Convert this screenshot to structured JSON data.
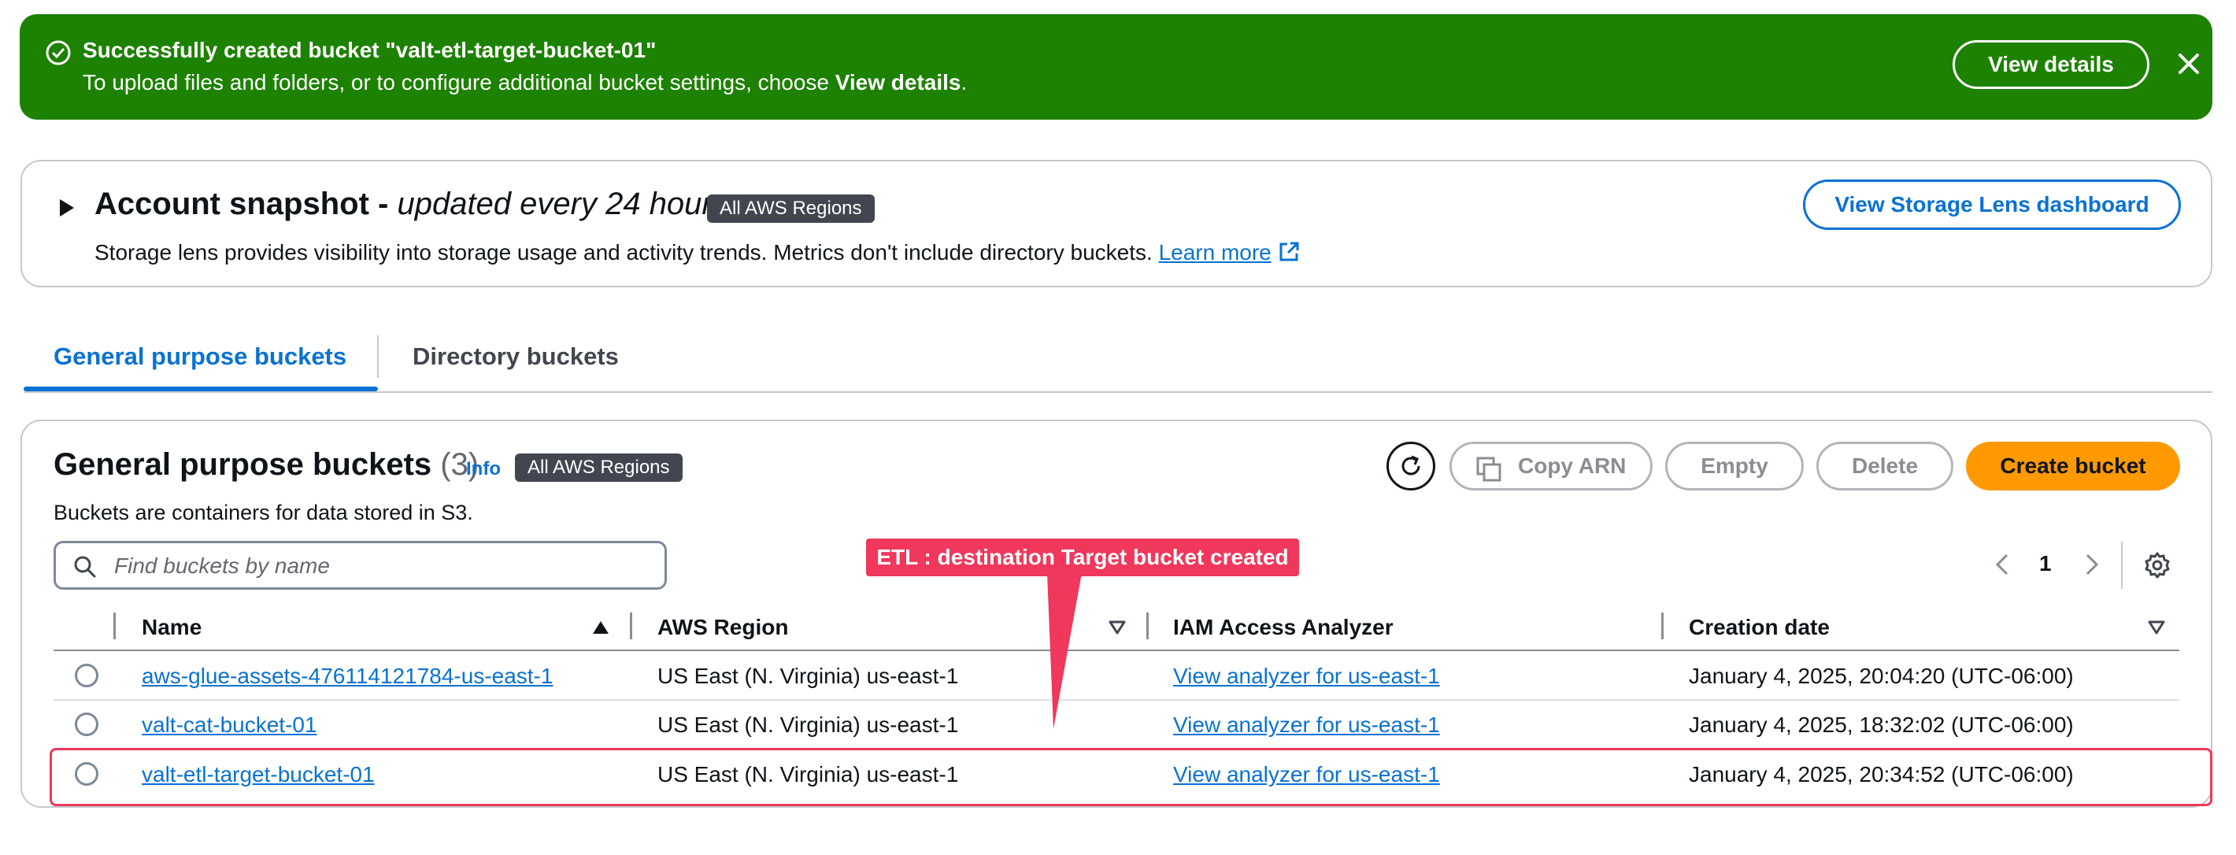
{
  "flash": {
    "title": "Successfully created bucket \"valt-etl-target-bucket-01\"",
    "message_prefix": "To upload files and folders, or to configure additional bucket settings, choose ",
    "message_bold": "View details",
    "message_suffix": ".",
    "view_details_label": "View details"
  },
  "snapshot": {
    "title_bold": "Account snapshot - ",
    "title_italic": "updated every 24 hours",
    "badge": "All AWS Regions",
    "description": "Storage lens provides visibility into storage usage and activity trends. Metrics don't include directory buckets.",
    "learn_more": "Learn more",
    "button_label": "View Storage Lens dashboard"
  },
  "tabs": [
    {
      "label": "General purpose buckets",
      "active": true
    },
    {
      "label": "Directory buckets",
      "active": false
    }
  ],
  "buckets_panel": {
    "title": "General purpose buckets",
    "count": "(3)",
    "info": "Info",
    "badge": "All AWS Regions",
    "description": "Buckets are containers for data stored in S3.",
    "copy_arn": "Copy ARN",
    "empty": "Empty",
    "delete": "Delete",
    "create": "Create bucket",
    "search_placeholder": "Find buckets by name",
    "page": "1"
  },
  "table": {
    "columns": [
      "Name",
      "AWS Region",
      "IAM Access Analyzer",
      "Creation date"
    ],
    "rows": [
      {
        "name": "aws-glue-assets-476114121784-us-east-1",
        "region": "US East (N. Virginia) us-east-1",
        "analyzer": "View analyzer for us-east-1",
        "created": "January 4, 2025, 20:04:20 (UTC-06:00)"
      },
      {
        "name": "valt-cat-bucket-01",
        "region": "US East (N. Virginia) us-east-1",
        "analyzer": "View analyzer for us-east-1",
        "created": "January 4, 2025, 18:32:02 (UTC-06:00)"
      },
      {
        "name": "valt-etl-target-bucket-01",
        "region": "US East (N. Virginia) us-east-1",
        "analyzer": "View analyzer for us-east-1",
        "created": "January 4, 2025, 20:34:52 (UTC-06:00)"
      }
    ]
  },
  "annotation": {
    "label": "ETL : destination Target bucket created"
  },
  "colors": {
    "success": "#1d8102",
    "link": "#0972d3",
    "primary_button": "#ff9900",
    "annotation": "#f0375c"
  }
}
